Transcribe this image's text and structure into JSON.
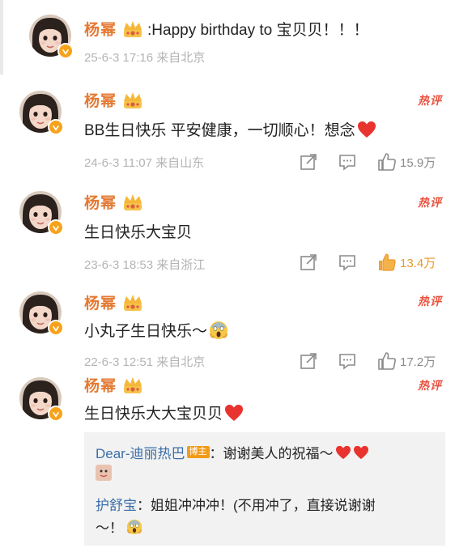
{
  "comments": [
    {
      "name": "杨幂",
      "text": ":Happy birthday to 宝贝贝！！！",
      "meta": "25-6-3 17:16 来自北京",
      "hot": "",
      "likes": ""
    },
    {
      "name": "杨幂",
      "text": "BB生日快乐 平安健康，一切顺心！想念",
      "meta": "24-6-3 11:07 来自山东",
      "hot": "热评",
      "likes": "15.9万",
      "liked": false
    },
    {
      "name": "杨幂",
      "text": "生日快乐大宝贝",
      "meta": "23-6-3 18:53 来自浙江",
      "hot": "热评",
      "likes": "13.4万",
      "liked": true
    },
    {
      "name": "杨幂",
      "text": "小丸子生日快乐～",
      "meta": "22-6-3 12:51 来自北京",
      "hot": "热评",
      "likes": "17.2万",
      "liked": false
    },
    {
      "name": "杨幂",
      "text": "生日快乐大大宝贝贝",
      "meta": "",
      "hot": "热评",
      "likes": ""
    }
  ],
  "replies": [
    {
      "name": "Dear-迪丽热巴",
      "badge": "博主",
      "text": "：谢谢美人的祝福～"
    },
    {
      "name": "护舒宝",
      "text_line1": "：姐姐冲冲冲！(不用冲了，直接说谢谢",
      "text_line2": "～！"
    }
  ],
  "colors": {
    "name": "#e47a34",
    "hot": "#e9523f",
    "reply_name": "#3b6ea8",
    "like_active": "#e79a2c",
    "heart": "#e8332f"
  },
  "icons": [
    "vip-crown-icon",
    "verified-badge-icon",
    "share-icon",
    "comment-icon",
    "like-icon",
    "heart-emoji-icon",
    "scream-emoji-icon"
  ]
}
